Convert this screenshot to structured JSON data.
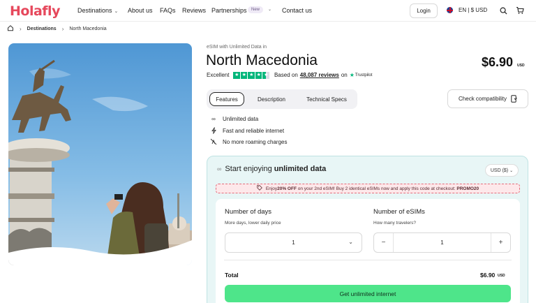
{
  "header": {
    "logo": "Holafly",
    "nav": [
      {
        "label": "Destinations"
      },
      {
        "label": "About us"
      },
      {
        "label": "FAQs"
      },
      {
        "label": "Reviews"
      },
      {
        "label": "Partnerships"
      },
      {
        "label": "Contact us"
      }
    ],
    "new_badge": "New",
    "login": "Login",
    "lang": "EN | $ USD"
  },
  "breadcrumb": {
    "current_section": "Destinations",
    "page": "North Macedonia"
  },
  "product": {
    "eyebrow": "eSIM with Unlimited Data in",
    "title": "North Macedonia",
    "price": "$6.90",
    "price_currency": "USD",
    "rating_word": "Excellent",
    "rating_stars": 4.5,
    "based_on": "Based on",
    "reviews": "48,087 reviews",
    "on": "on",
    "trustpilot": "Trustpilot"
  },
  "tabs": [
    "Features",
    "Description",
    "Technical Specs"
  ],
  "compat_button": "Check compatibility",
  "features": [
    "Unlimited data",
    "Fast and reliable internet",
    "No more roaming charges"
  ],
  "card": {
    "title_prefix": "Start enjoying",
    "title_bold": "unlimited data",
    "currency_select": "USD ($)",
    "promo": {
      "p1": "Enjoy ",
      "b1": "20% OFF",
      "p2": " on your 2nd eSIM! Buy 2 identical eSIMs now and apply this code at checkout: ",
      "code": "PROMO20"
    },
    "days_label": "Number of days",
    "days_sub": "More days, lower daily price",
    "days_value": "1",
    "esims_label": "Number of eSIMs",
    "esims_sub": "How many travelers?",
    "esims_value": "1",
    "total_label": "Total",
    "total_value": "$6.90",
    "total_currency": "USD",
    "buy_button": "Get unlimited internet"
  }
}
